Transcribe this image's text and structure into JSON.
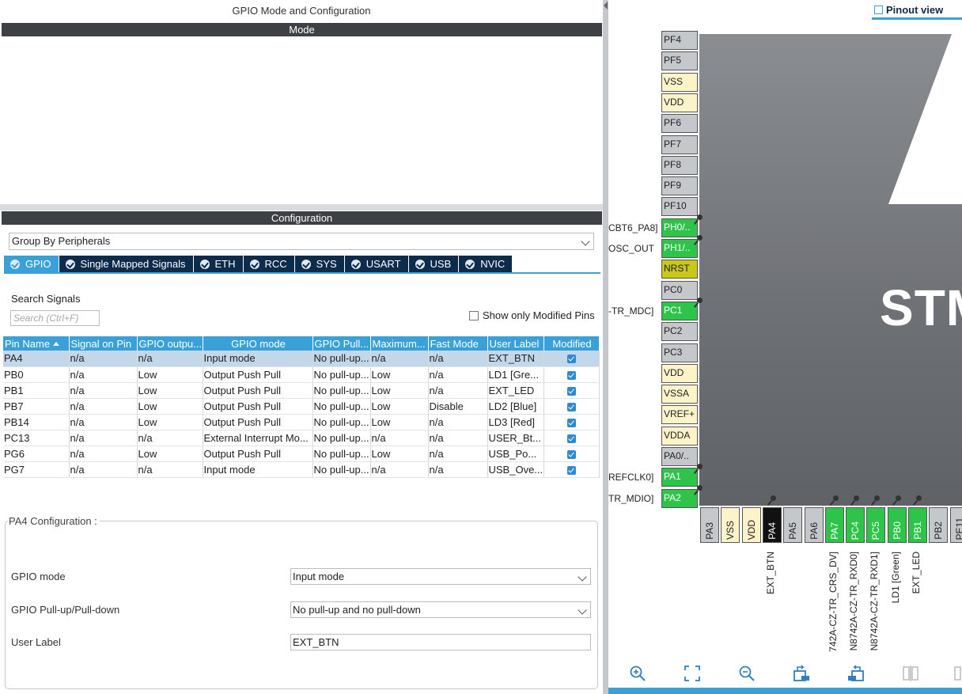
{
  "left": {
    "title": "GPIO Mode and Configuration",
    "mode_header": "Mode",
    "config_header": "Configuration",
    "group_by": "Group By Peripherals",
    "tabs": [
      {
        "label": "GPIO",
        "active": true
      },
      {
        "label": "Single Mapped Signals"
      },
      {
        "label": "ETH"
      },
      {
        "label": "RCC"
      },
      {
        "label": "SYS"
      },
      {
        "label": "USART"
      },
      {
        "label": "USB"
      },
      {
        "label": "NVIC"
      }
    ],
    "search": {
      "label": "Search Signals",
      "placeholder": "Search (Ctrl+F)"
    },
    "show_modified_label": "Show only Modified Pins",
    "table": {
      "columns": [
        "Pin Name",
        "Signal on Pin",
        "GPIO outpu...",
        "GPIO mode",
        "GPIO Pull...",
        "Maximum...",
        "Fast Mode",
        "User Label",
        "Modified"
      ],
      "rows": [
        [
          "PA4",
          "n/a",
          "n/a",
          "Input mode",
          "No pull-up...",
          "n/a",
          "n/a",
          "EXT_BTN"
        ],
        [
          "PB0",
          "n/a",
          "Low",
          "Output Push Pull",
          "No pull-up...",
          "Low",
          "n/a",
          "LD1 [Gre..."
        ],
        [
          "PB1",
          "n/a",
          "Low",
          "Output Push Pull",
          "No pull-up...",
          "Low",
          "n/a",
          "EXT_LED"
        ],
        [
          "PB7",
          "n/a",
          "Low",
          "Output Push Pull",
          "No pull-up...",
          "Low",
          "Disable",
          "LD2 [Blue]"
        ],
        [
          "PB14",
          "n/a",
          "Low",
          "Output Push Pull",
          "No pull-up...",
          "Low",
          "n/a",
          "LD3 [Red]"
        ],
        [
          "PC13",
          "n/a",
          "n/a",
          "External Interrupt Mo...",
          "No pull-up...",
          "n/a",
          "n/a",
          "USER_Bt..."
        ],
        [
          "PG6",
          "n/a",
          "Low",
          "Output Push Pull",
          "No pull-up...",
          "Low",
          "n/a",
          "USB_Po..."
        ],
        [
          "PG7",
          "n/a",
          "n/a",
          "Input mode",
          "No pull-up...",
          "n/a",
          "n/a",
          "USB_Ove..."
        ]
      ]
    },
    "pa4_config": {
      "title": "PA4 Configuration :",
      "gpio_mode_label": "GPIO mode",
      "gpio_mode_value": "Input mode",
      "pull_label": "GPIO Pull-up/Pull-down",
      "pull_value": "No pull-up and no pull-down",
      "user_label_label": "User Label",
      "user_label_value": "EXT_BTN"
    }
  },
  "right": {
    "tab_label": "Pinout view",
    "chip_text": "STM",
    "left_pins": [
      {
        "name": "PF4",
        "color": "gray"
      },
      {
        "name": "PF5",
        "color": "gray"
      },
      {
        "name": "VSS",
        "color": "yellow"
      },
      {
        "name": "VDD",
        "color": "yellow"
      },
      {
        "name": "PF6",
        "color": "gray"
      },
      {
        "name": "PF7",
        "color": "gray"
      },
      {
        "name": "PF8",
        "color": "gray"
      },
      {
        "name": "PF9",
        "color": "gray"
      },
      {
        "name": "PF10",
        "color": "gray"
      },
      {
        "name": "PH0/..",
        "color": "green",
        "label": "CBT6_PA8]"
      },
      {
        "name": "PH1/..",
        "color": "green",
        "label": "OSC_OUT"
      },
      {
        "name": "NRST",
        "color": "olive"
      },
      {
        "name": "PC0",
        "color": "gray"
      },
      {
        "name": "PC1",
        "color": "green",
        "label": "-TR_MDC]"
      },
      {
        "name": "PC2",
        "color": "gray"
      },
      {
        "name": "PC3",
        "color": "gray"
      },
      {
        "name": "VDD",
        "color": "yellow"
      },
      {
        "name": "VSSA",
        "color": "yellow"
      },
      {
        "name": "VREF+",
        "color": "yellow"
      },
      {
        "name": "VDDA",
        "color": "yellow"
      },
      {
        "name": "PA0/..",
        "color": "gray"
      },
      {
        "name": "PA1",
        "color": "green",
        "label": "REFCLK0]"
      },
      {
        "name": "PA2",
        "color": "green",
        "label": "TR_MDIO]"
      }
    ],
    "bottom_pins": [
      {
        "name": "PA3",
        "color": "gray"
      },
      {
        "name": "VSS",
        "color": "yellow"
      },
      {
        "name": "VDD",
        "color": "yellow"
      },
      {
        "name": "PA4",
        "color": "black",
        "label": "EXT_BTN"
      },
      {
        "name": "PA5",
        "color": "gray"
      },
      {
        "name": "PA6",
        "color": "gray"
      },
      {
        "name": "PA7",
        "color": "green",
        "label": "742A-CZ-TR_CRS_DV]"
      },
      {
        "name": "PC4",
        "color": "green",
        "label": "N8742A-CZ-TR_RXD0]"
      },
      {
        "name": "PC5",
        "color": "green",
        "label": "N8742A-CZ-TR_RXD1]"
      },
      {
        "name": "PB0",
        "color": "green",
        "label": "LD1 [Green]"
      },
      {
        "name": "PB1",
        "color": "green",
        "label": "EXT_LED"
      },
      {
        "name": "PB2",
        "color": "gray"
      },
      {
        "name": "PE11",
        "color": "gray"
      }
    ],
    "toolbar": [
      "zoom-in-icon",
      "fit-screen-icon",
      "zoom-out-icon",
      "rotate-right-icon",
      "rotate-left-icon",
      "split-view-icon",
      "more-icon"
    ]
  }
}
